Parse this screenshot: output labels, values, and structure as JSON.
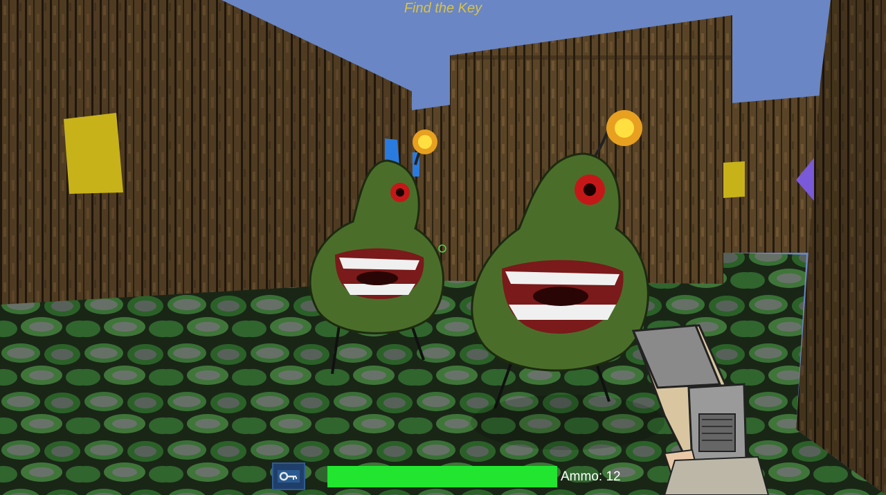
{
  "hud": {
    "objective": "Find the Key",
    "ammo_label": "Ammo:",
    "ammo_value": "12",
    "health_fraction": 1.0,
    "key_icon": "key-icon"
  },
  "colors": {
    "sky": "#6a86c4",
    "health": "#22e52f",
    "objective_text": "#d8c24a",
    "enemy_body": "#4a6e2a",
    "floor": "#3c7a3a"
  },
  "scene": {
    "enemies": [
      "pear-bomb-monster",
      "pear-bomb-monster"
    ],
    "weapon": "pistol",
    "markers": [
      "yellow-square",
      "blue-marker",
      "yellow-square",
      "purple-triangle"
    ]
  }
}
